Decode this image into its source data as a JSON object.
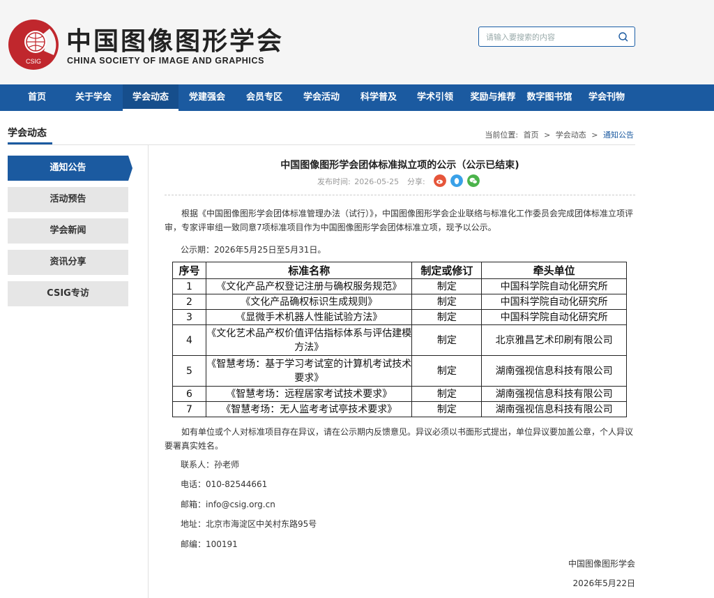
{
  "header": {
    "logo_text": "CSIG",
    "org_name_cn": "中国图像图形学会",
    "org_name_en": "CHINA SOCIETY OF IMAGE AND GRAPHICS",
    "search_placeholder": "请输入要搜索的内容"
  },
  "nav": [
    {
      "label": "首页"
    },
    {
      "label": "关于学会"
    },
    {
      "label": "学会动态",
      "active": true
    },
    {
      "label": "党建强会"
    },
    {
      "label": "会员专区"
    },
    {
      "label": "学会活动"
    },
    {
      "label": "科学普及"
    },
    {
      "label": "学术引领"
    },
    {
      "label": "奖励与推荐"
    },
    {
      "label": "数字图书馆"
    },
    {
      "label": "学会刊物"
    }
  ],
  "section": {
    "title": "学会动态",
    "breadcrumb": {
      "prefix": "当前位置:",
      "items": [
        "首页",
        "学会动态",
        "通知公告"
      ],
      "separator": ">"
    }
  },
  "sidebar": [
    {
      "label": "通知公告",
      "active": true
    },
    {
      "label": "活动预告"
    },
    {
      "label": "学会新闻"
    },
    {
      "label": "资讯分享"
    },
    {
      "label": "CSIG专访"
    }
  ],
  "article": {
    "title": "中国图像图形学会团体标准拟立项的公示（公示已结束)",
    "publish_label": "发布时间:",
    "publish_date": "2026-05-25",
    "share_label": "分享:",
    "intro": "根据《中国图像图形学会团体标准管理办法（试行）》，中国图像图形学会企业联络与标准化工作委员会完成团体标准立项评审，专家评审组一致同意7项标准项目作为中国图像图形学会团体标准立项，现予以公示。",
    "period": "公示期：2026年5月25日至5月31日。",
    "table": {
      "headers": [
        "序号",
        "标准名称",
        "制定或修订",
        "牵头单位"
      ],
      "rows": [
        [
          "1",
          "《文化产品产权登记注册与确权服务规范》",
          "制定",
          "中国科学院自动化研究所"
        ],
        [
          "2",
          "《文化产品确权标识生成规则》",
          "制定",
          "中国科学院自动化研究所"
        ],
        [
          "3",
          "《显微手术机器人性能试验方法》",
          "制定",
          "中国科学院自动化研究所"
        ],
        [
          "4",
          "《文化艺术品产权价值评估指标体系与评估建模方法》",
          "制定",
          "北京雅昌艺术印刷有限公司"
        ],
        [
          "5",
          "《智慧考场：基于学习考试室的计算机考试技术要求》",
          "制定",
          "湖南强视信息科技有限公司"
        ],
        [
          "6",
          "《智慧考场：远程居家考试技术要求》",
          "制定",
          "湖南强视信息科技有限公司"
        ],
        [
          "7",
          "《智慧考场：无人监考考试亭技术要求》",
          "制定",
          "湖南强视信息科技有限公司"
        ]
      ]
    },
    "objection": "如有单位或个人对标准项目存在异议，请在公示期内反馈意见。异议必须以书面形式提出，单位异议要加盖公章，个人异议要署真实姓名。",
    "contact": [
      "联系人：孙老师",
      "电话：010-82544661",
      "邮箱：info@csig.org.cn",
      "地址：北京市海淀区中关村东路95号",
      "邮编：100191"
    ],
    "signature": "中国图像图形学会",
    "sign_date": "2026年5月22日"
  },
  "colors": {
    "primary": "#1b5aa0",
    "logo_red": "#c0272d",
    "weibo": "#e6553a",
    "qq": "#3aa1e8",
    "wechat": "#4bb34b"
  }
}
